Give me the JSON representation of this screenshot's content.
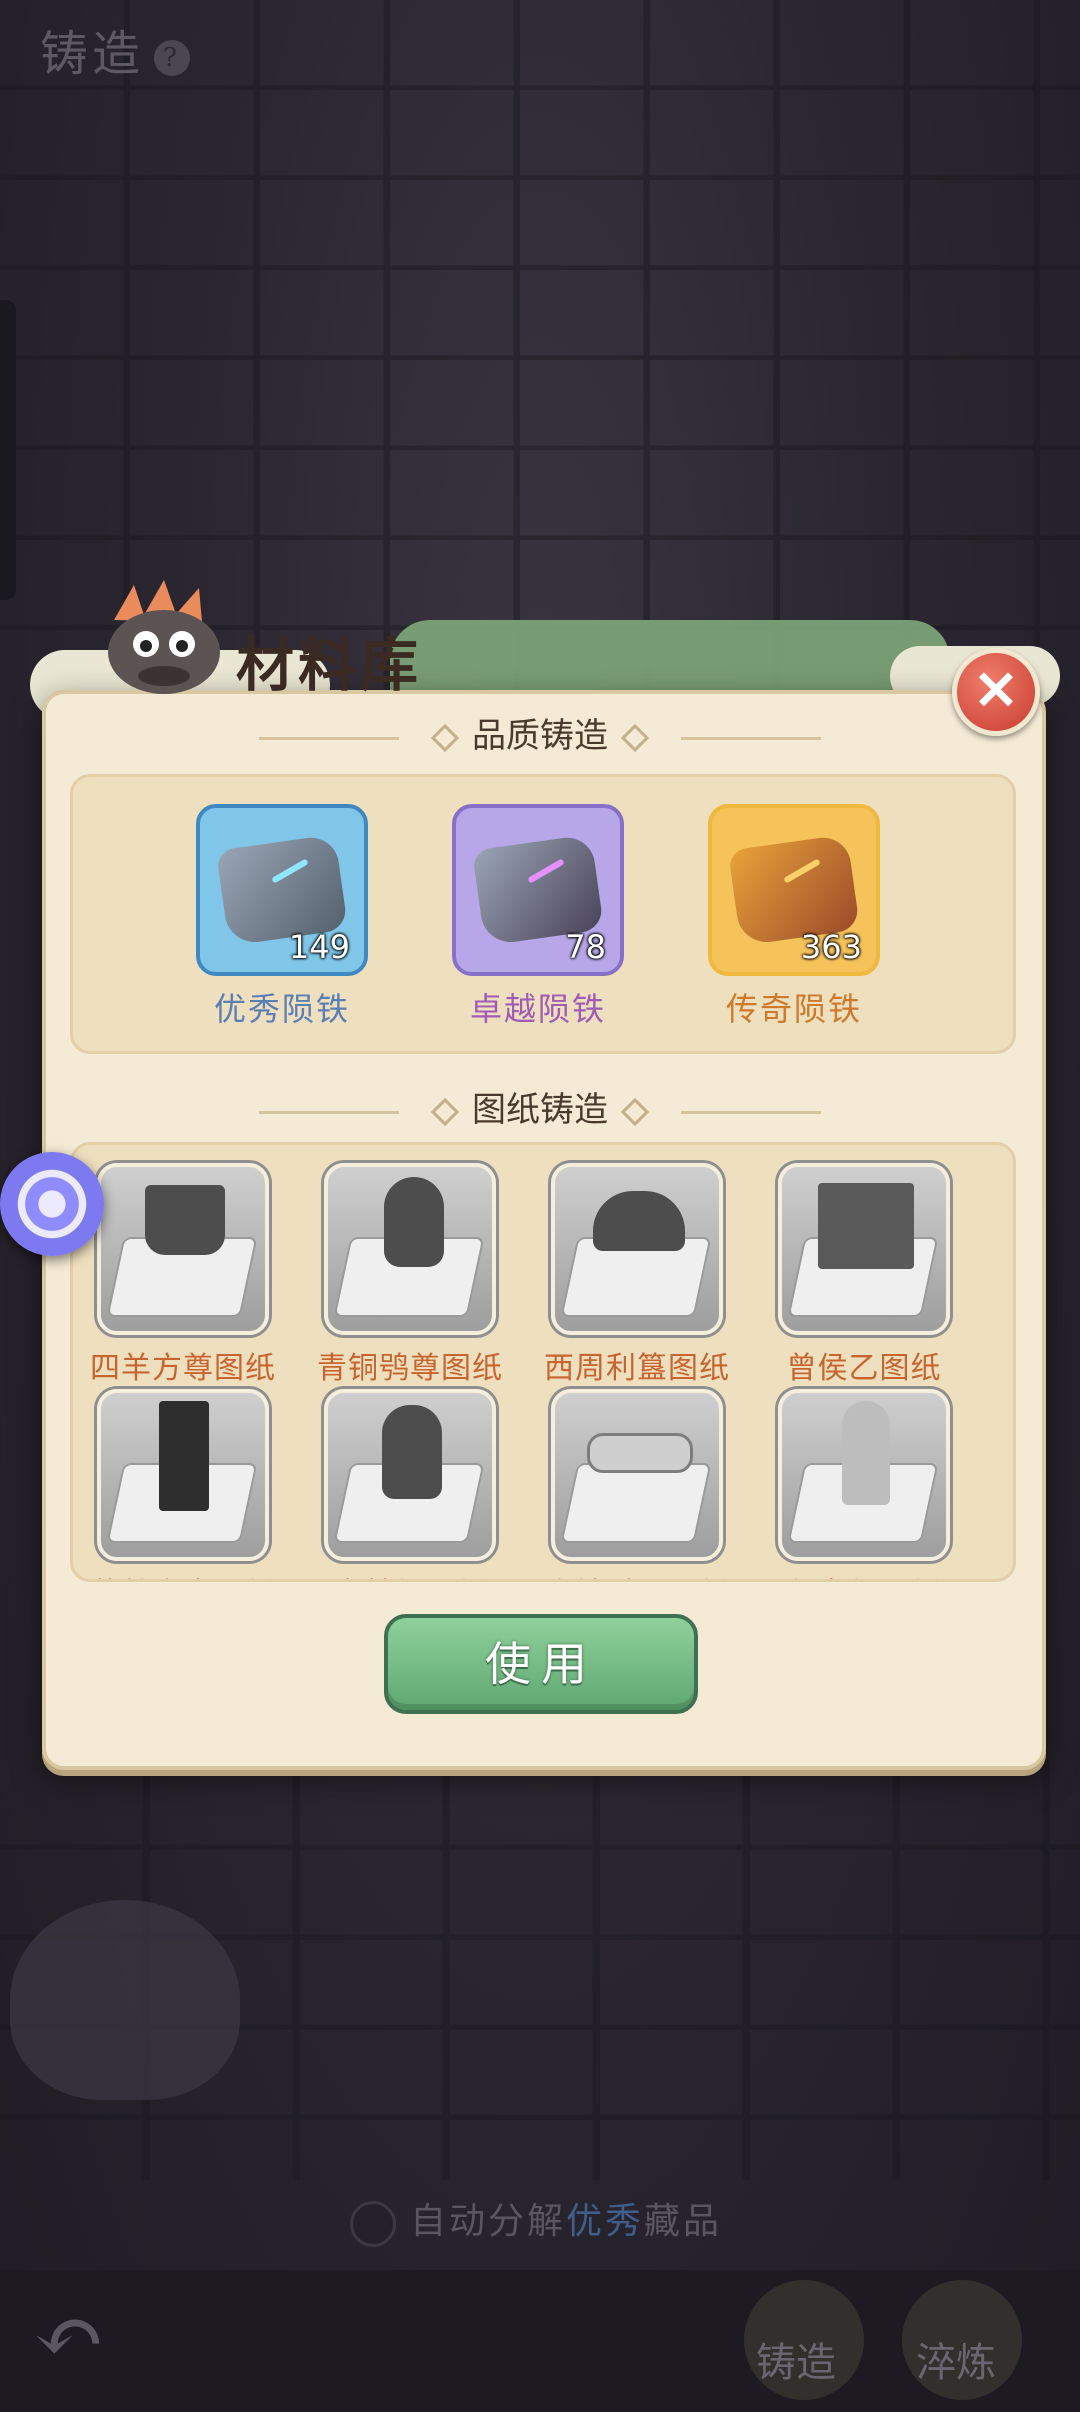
{
  "background": {
    "title": "铸造",
    "help_icon": "question-icon",
    "auto_decompose": {
      "prefix": "自动分解",
      "quality": "优秀",
      "suffix": "藏品"
    },
    "bottom_nav": {
      "back_icon": "back-arrow-icon",
      "forge_label": "铸造",
      "second_label": "淬炼"
    }
  },
  "dialog": {
    "title": "材料库",
    "close_icon": "close-x-icon",
    "quality_section": {
      "heading": "品质铸造",
      "materials": [
        {
          "name": "优秀陨铁",
          "count": "149",
          "color": "#5b7fb5",
          "slot_color": "#7fc6e8",
          "border": "#3f88c2"
        },
        {
          "name": "卓越陨铁",
          "count": "78",
          "color": "#a05bb5",
          "slot_color": "#b7a7e8",
          "border": "#8770c8"
        },
        {
          "name": "传奇陨铁",
          "count": "363",
          "color": "#cf7a2a",
          "slot_color": "#f6c25a",
          "border": "#f0b83c"
        }
      ]
    },
    "blueprint_section": {
      "heading": "图纸铸造",
      "items": [
        {
          "name": "四羊方尊图纸"
        },
        {
          "name": "青铜鸮尊图纸"
        },
        {
          "name": "西周利簋图纸"
        },
        {
          "name": "曾侯乙图纸"
        },
        {
          "name": "莲鹤方壶图纸"
        },
        {
          "name": "击鼓俑图纸"
        },
        {
          "name": "洛神赋图图纸"
        },
        {
          "name": "仕女俑图纸"
        }
      ]
    },
    "use_button": "使用"
  },
  "floating_button_icon": "swirl-icon"
}
